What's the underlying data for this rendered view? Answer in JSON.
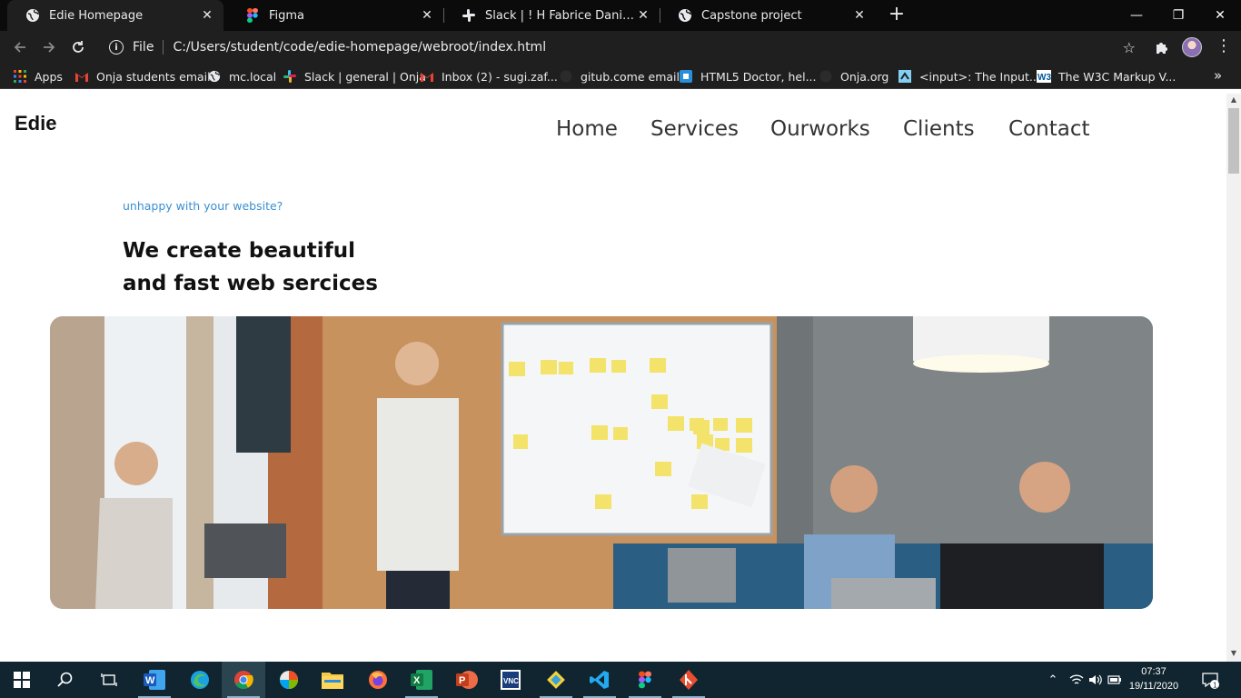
{
  "browser": {
    "tabs": [
      {
        "title": "Edie Homepage",
        "icon": "globe-icon",
        "active": true
      },
      {
        "title": "Figma",
        "icon": "figma-icon",
        "active": false
      },
      {
        "title": "Slack | ! H Fabrice Daniel | Onja |",
        "icon": "slack-icon",
        "active": false
      },
      {
        "title": "Capstone project",
        "icon": "globe-icon",
        "active": false
      }
    ],
    "close_glyph": "✕",
    "new_tab_glyph": "+",
    "window_controls": {
      "minimize": "—",
      "restore": "❐",
      "close": "✕"
    },
    "address_bar": {
      "scheme_label": "File",
      "url": "C:/Users/student/code/edie-homepage/webroot/index.html"
    },
    "bookmarks": [
      {
        "label": "Apps",
        "icon": "apps-grid-icon"
      },
      {
        "label": "Onja students email",
        "icon": "gmail-icon"
      },
      {
        "label": "mc.local",
        "icon": "globe-icon"
      },
      {
        "label": "Slack | general | Onja",
        "icon": "slack-icon"
      },
      {
        "label": "Inbox (2) - sugi.zaf...",
        "icon": "gmail-icon"
      },
      {
        "label": "gitub.come email",
        "icon": "github-icon"
      },
      {
        "label": "HTML5 Doctor, hel...",
        "icon": "html5doctor-icon"
      },
      {
        "label": "Onja.org",
        "icon": "onja-icon"
      },
      {
        "label": "<input>: The Input...",
        "icon": "mdn-icon"
      },
      {
        "label": "The W3C Markup V...",
        "icon": "w3c-icon"
      }
    ],
    "bookmarks_overflow": "»"
  },
  "page": {
    "logo": "Edie",
    "nav": [
      "Home",
      "Services",
      "Ourworks",
      "Clients",
      "Contact"
    ],
    "eyebrow": "unhappy with your website?",
    "headline_line1": "We create beautiful",
    "headline_line2": "and fast web sercices"
  },
  "taskbar": {
    "apps": [
      "start-icon",
      "search-icon",
      "task-view-icon",
      "word-icon",
      "edge-icon",
      "chrome-icon",
      "photos-icon",
      "file-explorer-icon",
      "firefox-icon",
      "excel-icon",
      "powerpoint-icon",
      "vnc-viewer-icon",
      "git-icon",
      "vscode-icon",
      "figma-icon",
      "git-bash-icon"
    ],
    "time": "07:37",
    "date": "19/11/2020",
    "notification_count": "1"
  },
  "colors": {
    "accent_blue": "#3a8fd1",
    "nav_text": "#333333",
    "chrome_dark": "#1f1f1f",
    "taskbar": "#10252f"
  }
}
